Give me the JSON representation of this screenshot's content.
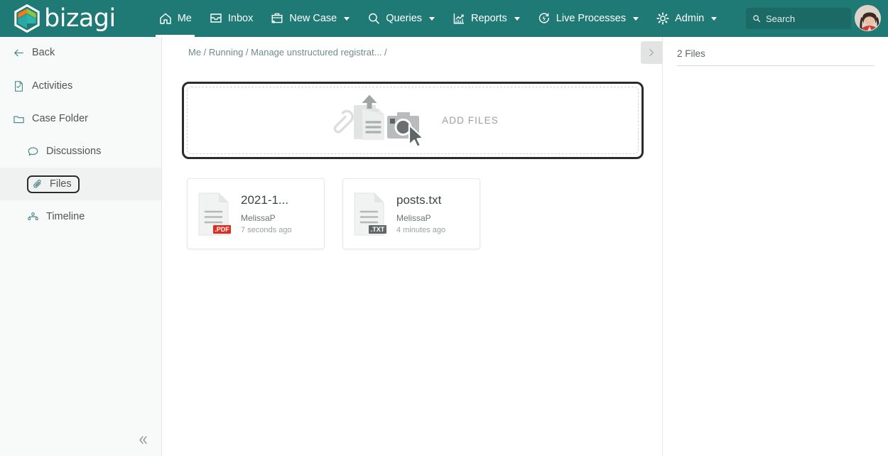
{
  "header": {
    "brand": "bizagi",
    "brand_logo_icon": "bizagi-hexagon-logo",
    "nav": [
      {
        "label": "Me",
        "icon": "home-icon",
        "active": true,
        "caret": false
      },
      {
        "label": "Inbox",
        "icon": "inbox-tray-icon",
        "active": false,
        "caret": false
      },
      {
        "label": "New Case",
        "icon": "briefcase-plus-icon",
        "active": false,
        "caret": true
      },
      {
        "label": "Queries",
        "icon": "magnifier-icon",
        "active": false,
        "caret": true
      },
      {
        "label": "Reports",
        "icon": "bar-chart-icon",
        "active": false,
        "caret": true
      },
      {
        "label": "Live Processes",
        "icon": "lightning-circle-icon",
        "active": false,
        "caret": true
      },
      {
        "label": "Admin",
        "icon": "gear-icon",
        "active": false,
        "caret": true
      }
    ],
    "search": {
      "placeholder": "Search",
      "value": "",
      "icon": "search-icon"
    },
    "avatar_icon": "user-avatar",
    "accent_color": "#1f7a75"
  },
  "sidebar": {
    "back_label": "Back",
    "back_icon": "arrow-left-icon",
    "collapse_icon": "double-chevron-left-icon",
    "items": [
      {
        "label": "Activities",
        "icon": "document-check-icon",
        "indent": false,
        "selected": false
      },
      {
        "label": "Case Folder",
        "icon": "folder-icon",
        "indent": false,
        "selected": false
      },
      {
        "label": "Discussions",
        "icon": "speech-bubble-icon",
        "indent": true,
        "selected": false
      },
      {
        "label": "Files",
        "icon": "paperclip-icon",
        "indent": true,
        "selected": true
      },
      {
        "label": "Timeline",
        "icon": "timeline-nodes-icon",
        "indent": true,
        "selected": false
      }
    ]
  },
  "main": {
    "breadcrumb": "Me / Running / Manage unstructured registrat... /",
    "panel_toggle_icon": "chevron-right-icon",
    "dropzone": {
      "label": "ADD FILES",
      "icons": [
        "paperclip-icon",
        "document-upload-icon",
        "camera-icon",
        "cursor-arrow-icon"
      ]
    },
    "files": [
      {
        "name": "2021-1...",
        "ext_badge": "·PDF",
        "badge_color": "#e02b20",
        "user": "MelissaP",
        "time": "7 seconds ago",
        "icon": "file-document-icon"
      },
      {
        "name": "posts.txt",
        "ext_badge": "·TXT",
        "badge_color": "#5f6768",
        "user": "MelissaP",
        "time": "4 minutes ago",
        "icon": "file-document-icon"
      }
    ]
  },
  "right_panel": {
    "title": "2 Files"
  }
}
